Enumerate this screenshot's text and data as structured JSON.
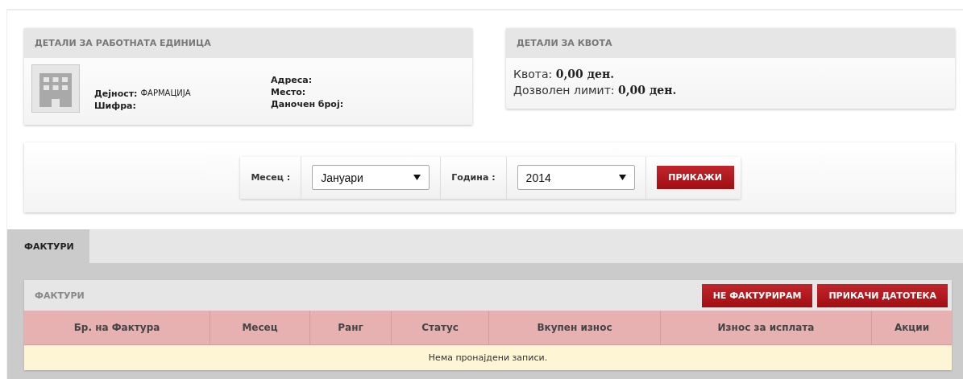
{
  "unit_card": {
    "title": "ДЕТАЛИ ЗА РАБОТНАТА ЕДИНИЦА",
    "left_fields": [
      {
        "label": "Дејност:",
        "value": "ФАРМАЦИЈА"
      },
      {
        "label": "Шифра:"
      }
    ],
    "right_fields": [
      {
        "label": "Адреса:"
      },
      {
        "label": "Место:"
      },
      {
        "label": "Даночен број:"
      }
    ]
  },
  "quota_card": {
    "title": "ДЕТАЛИ ЗА КВОТА",
    "lines": [
      {
        "label": "Квота:",
        "value": "0,00 ден."
      },
      {
        "label": "Дозволен лимит:",
        "value": "0,00 ден."
      }
    ]
  },
  "filter": {
    "month_label": "Месец :",
    "month_value": "Јануари",
    "year_label": "Година :",
    "year_value": "2014",
    "button": "ПРИКАЖИ"
  },
  "tabs": [
    {
      "label": "ФАКТУРИ",
      "selected": true
    }
  ],
  "invoices": {
    "title": "ФАКТУРИ",
    "buttons": [
      "НЕ ФАКТУРИРАМ",
      "ПРИКАЧИ ДАТОТЕКА"
    ],
    "columns": [
      "Бр. на Фактура",
      "Месец",
      "Ранг",
      "Статус",
      "Вкупен износ",
      "Износ за исплата",
      "Акции"
    ],
    "empty_message": "Нема пронајдени записи."
  }
}
